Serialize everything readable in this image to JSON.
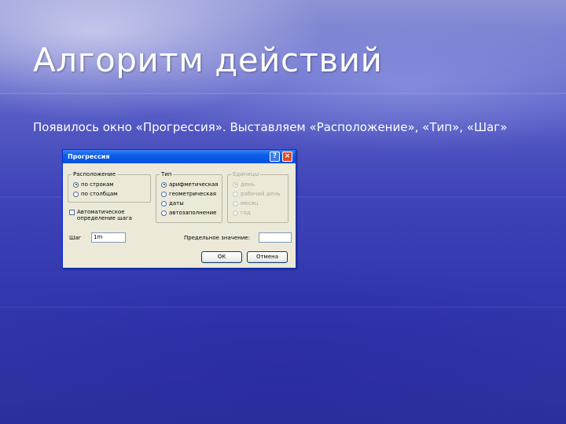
{
  "slide": {
    "title": "Алгоритм действий",
    "text": "Появилось окно «Прогрессия». Выставляем «Расположение», «Тип», «Шаг»"
  },
  "dialog": {
    "title": "Прогрессия",
    "help_label": "?",
    "close_label": "×",
    "location": {
      "label": "Расположение",
      "options": [
        "по строкам",
        "по столбцам"
      ],
      "selected": "по строкам"
    },
    "type": {
      "label": "Тип",
      "options": [
        "арифметическая",
        "геометрическая",
        "даты",
        "автозаполнение"
      ],
      "selected": "арифметическая"
    },
    "units": {
      "label": "Единицы",
      "options": [
        "день",
        "рабочий день",
        "месяц",
        "год"
      ],
      "selected": "день"
    },
    "auto_step_label_1": "Автоматическое",
    "auto_step_label_2": "определение шага",
    "step_label": "Шаг",
    "step_value": "1m",
    "limit_label": "Предельное значение:",
    "limit_value": "",
    "ok_label": "ОК",
    "cancel_label": "Отмена"
  }
}
